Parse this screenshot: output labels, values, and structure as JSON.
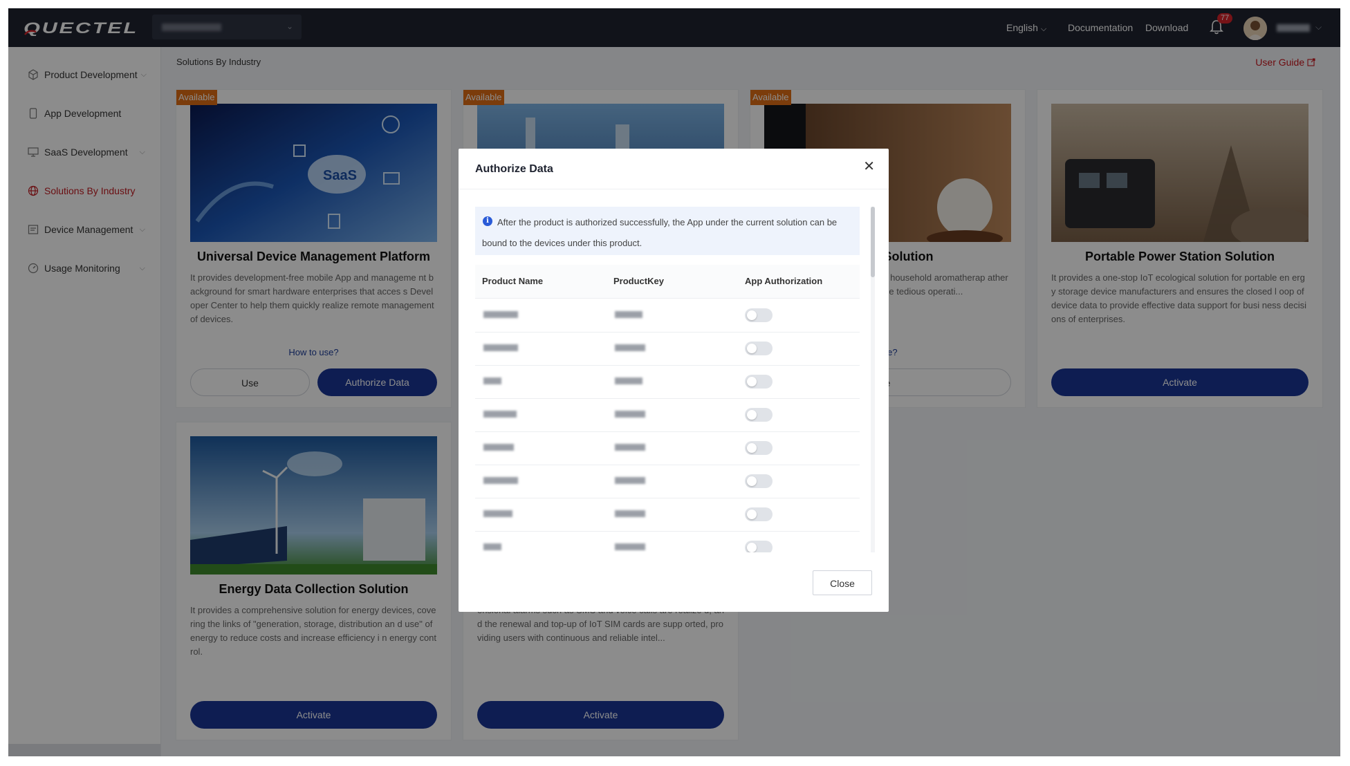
{
  "app": {
    "brand": "QUECTEL",
    "language": "English",
    "documentation": "Documentation",
    "download": "Download",
    "notification_count": "77",
    "colors": {
      "topbar": "#1f2330",
      "accent_red": "#c21b21",
      "primary_blue": "#1a3696",
      "available_orange": "#e06d14"
    }
  },
  "sidebar": {
    "items": [
      {
        "label": "Product Development",
        "icon": "cube-icon",
        "has_chevron": true
      },
      {
        "label": "App Development",
        "icon": "phone-icon",
        "has_chevron": false
      },
      {
        "label": "SaaS Development",
        "icon": "monitor-icon",
        "has_chevron": true
      },
      {
        "label": "Solutions By Industry",
        "icon": "globe-icon",
        "has_chevron": false,
        "active": true
      },
      {
        "label": "Device Management",
        "icon": "device-icon",
        "has_chevron": true
      },
      {
        "label": "Usage Monitoring",
        "icon": "gauge-icon",
        "has_chevron": true
      }
    ]
  },
  "page": {
    "breadcrumb": "Solutions By Industry",
    "user_guide": "User Guide"
  },
  "cards": [
    {
      "badge": "Available",
      "title": "Universal Device Management Platform",
      "description": "It provides development-free mobile App and manageme nt background for smart hardware enterprises that acces s Developer Center to help them quickly realize remote management of devices.",
      "how_to_use": "How to use?",
      "buttons": [
        "Use",
        "Authorize Data"
      ]
    },
    {
      "badge": "Available",
      "title": "",
      "description": "",
      "how_to_use": "",
      "buttons": []
    },
    {
      "badge": "Available",
      "title": "iffuser Solution",
      "description": "-stop intelligent solutions for as household aromatherap atherapy diffusers and fragr lifying the tedious operati...",
      "how_to_use": "use?",
      "buttons": [
        "e"
      ]
    },
    {
      "badge": "",
      "title": "Portable Power Station Solution",
      "description": "It provides a one-stop IoT ecological solution for portable en ergy storage device manufacturers and ensures the closed l oop of device data to provide effective data support for busi ness decisions of enterprises.",
      "how_to_use": "",
      "buttons": [
        "Activate"
      ]
    },
    {
      "badge": "",
      "title": "Energy Data Collection Solution",
      "description": "It provides a comprehensive solution for energy devices, covering the links of \"generation, storage, distribution an d use\" of energy to reduce costs and increase efficiency i n energy control.",
      "how_to_use": "",
      "buttons": [
        "Activate"
      ]
    },
    {
      "badge": "",
      "title": "",
      "description": "ensional alarms such as SMS and voice calls are realize d, and the renewal and top-up of IoT SIM cards are supp orted, providing users with continuous and reliable intel...",
      "how_to_use": "",
      "buttons": [
        "Activate"
      ]
    }
  ],
  "modal": {
    "title": "Authorize Data",
    "notice": "After the product is authorized successfully, the App under the current solution can be bound to the devices under this product.",
    "columns": [
      "Product Name",
      "ProductKey",
      "App Authorization"
    ],
    "rows": [
      {
        "enabled": false
      },
      {
        "enabled": false
      },
      {
        "enabled": false
      },
      {
        "enabled": false
      },
      {
        "enabled": false
      },
      {
        "enabled": false
      },
      {
        "enabled": false
      },
      {
        "enabled": false
      }
    ],
    "close_label": "Close"
  }
}
